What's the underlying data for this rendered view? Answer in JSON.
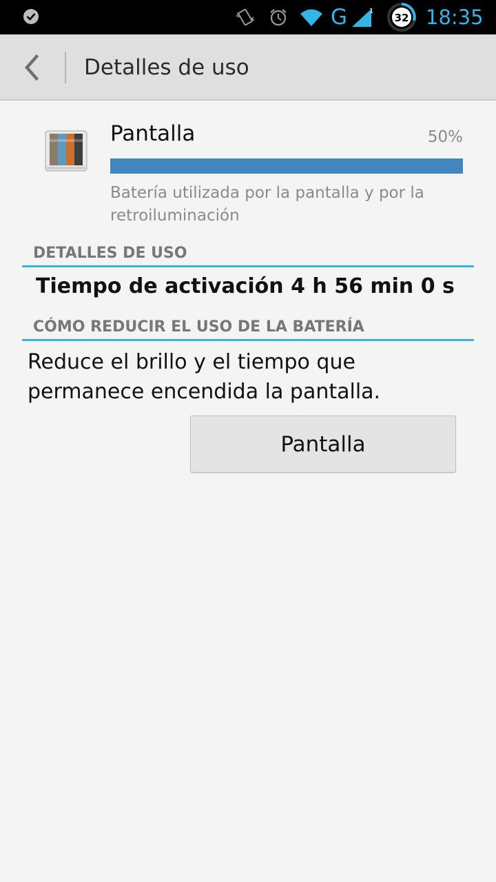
{
  "status_bar": {
    "network_type": "G",
    "signal_data_indicator": "1",
    "battery_level": "32",
    "time": "18:35",
    "accent_color": "#33b5e5",
    "icons": [
      "notification-check-icon",
      "vibrate-icon",
      "alarm-icon",
      "wifi-icon",
      "signal-icon",
      "battery-icon"
    ]
  },
  "action_bar": {
    "title": "Detalles de uso",
    "back_icon": "chevron-left-icon"
  },
  "item": {
    "name": "Pantalla",
    "percent_label": "50%",
    "usage_fraction": 0.5,
    "description": "Batería utilizada por la pantalla y por la retroiluminación",
    "icon": "display-icon",
    "bar_color": "#4187bd"
  },
  "details_section": {
    "header": "DETALLES DE USO",
    "activation_time": "Tiempo de activación 4 h 56 min 0 s"
  },
  "reduce_section": {
    "header": "CÓMO REDUCIR EL USO DE LA BATERÍA",
    "tip": "Reduce el brillo y el tiempo que permanece encendida la pantalla.",
    "button_label": "Pantalla"
  }
}
